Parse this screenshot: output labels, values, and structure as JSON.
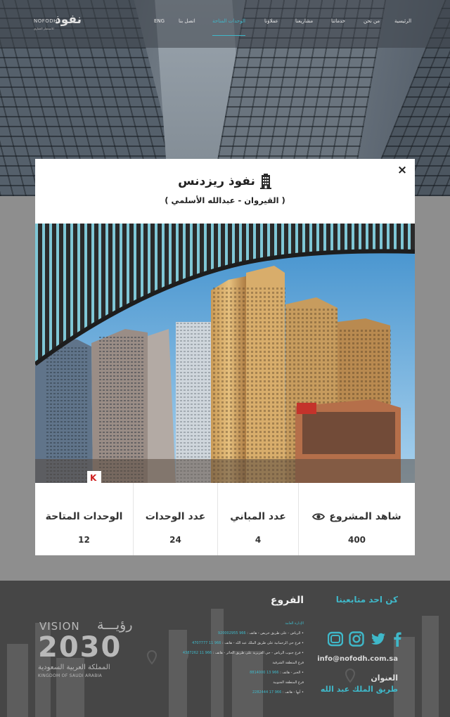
{
  "header": {
    "logo_en": "NOFODH",
    "logo_ar": "نفوذ",
    "logo_sub": "للاستثمار العقاري",
    "nav": [
      {
        "label": "الرئيسية",
        "active": false
      },
      {
        "label": "من نحن",
        "active": false
      },
      {
        "label": "خدماتنا",
        "active": false
      },
      {
        "label": "مشاريعنا",
        "active": false
      },
      {
        "label": "عملاؤنا",
        "active": false
      },
      {
        "label": "الوحدات المتاحة",
        "active": true
      },
      {
        "label": "اتصل بنا",
        "active": false
      },
      {
        "label": "ENG",
        "active": false
      }
    ]
  },
  "modal": {
    "close_label": "×",
    "title": "نفوذ ريزدنس",
    "title_icon": "building-icon",
    "subtitle": "( القيروان - عبدالله الأسلمي )",
    "photo_icon": "building-photo",
    "stats": [
      {
        "label": "شاهد المشروع",
        "value": "400",
        "icon": "eye-icon"
      },
      {
        "label": "عدد المباني",
        "value": "4"
      },
      {
        "label": "عدد الوحدات",
        "value": "24"
      },
      {
        "label": "الوحدات المتاحة",
        "value": "12"
      }
    ]
  },
  "footer": {
    "vision": {
      "line1": "VISION",
      "line1_ar": "رؤيـــة",
      "year": "2030",
      "country_ar": "المملكة العربية السعودية",
      "country_en": "KINGDOM OF SAUDI ARABIA"
    },
    "branches_title": "الفروع",
    "branches": [
      {
        "text": "الإدارة العامة",
        "phone": ""
      },
      {
        "text": "• الرياض - على طريق خريص - هاتف :",
        "phone": "966 920002955"
      },
      {
        "text": "• فرع حي الرحمانية على طريق الملك عبد الله - هاتف :",
        "phone": "966 11 4707777"
      },
      {
        "text": "• فرع جنوب الرياض - حي العزيزية على طريق الحائر - هاتف :",
        "phone": "966 11 4387262"
      },
      {
        "text": "فرع المنطقة الشرقية",
        "phone": ""
      },
      {
        "text": "• الخبر - هاتف :",
        "phone": "966 13 8814000"
      },
      {
        "text": "فرع المنطقة الجنوبية",
        "phone": ""
      },
      {
        "text": "• أبها - هاتف :",
        "phone": "966 17 2282444"
      }
    ],
    "follow_title": "كن احد متابعينا",
    "social_icons": [
      "facebook-icon",
      "twitter-icon",
      "instagram-icon",
      "youtube-icon"
    ],
    "email": "info@nofodh.com.sa",
    "address_title": "العنوان",
    "address": "طريق الملك عبد الله"
  },
  "colors": {
    "accent": "#3fb8c9",
    "footer_bg": "#464646",
    "page_overlay": "#8e8e8e",
    "modal_bg": "#ffffff",
    "text_dark": "#333333"
  }
}
